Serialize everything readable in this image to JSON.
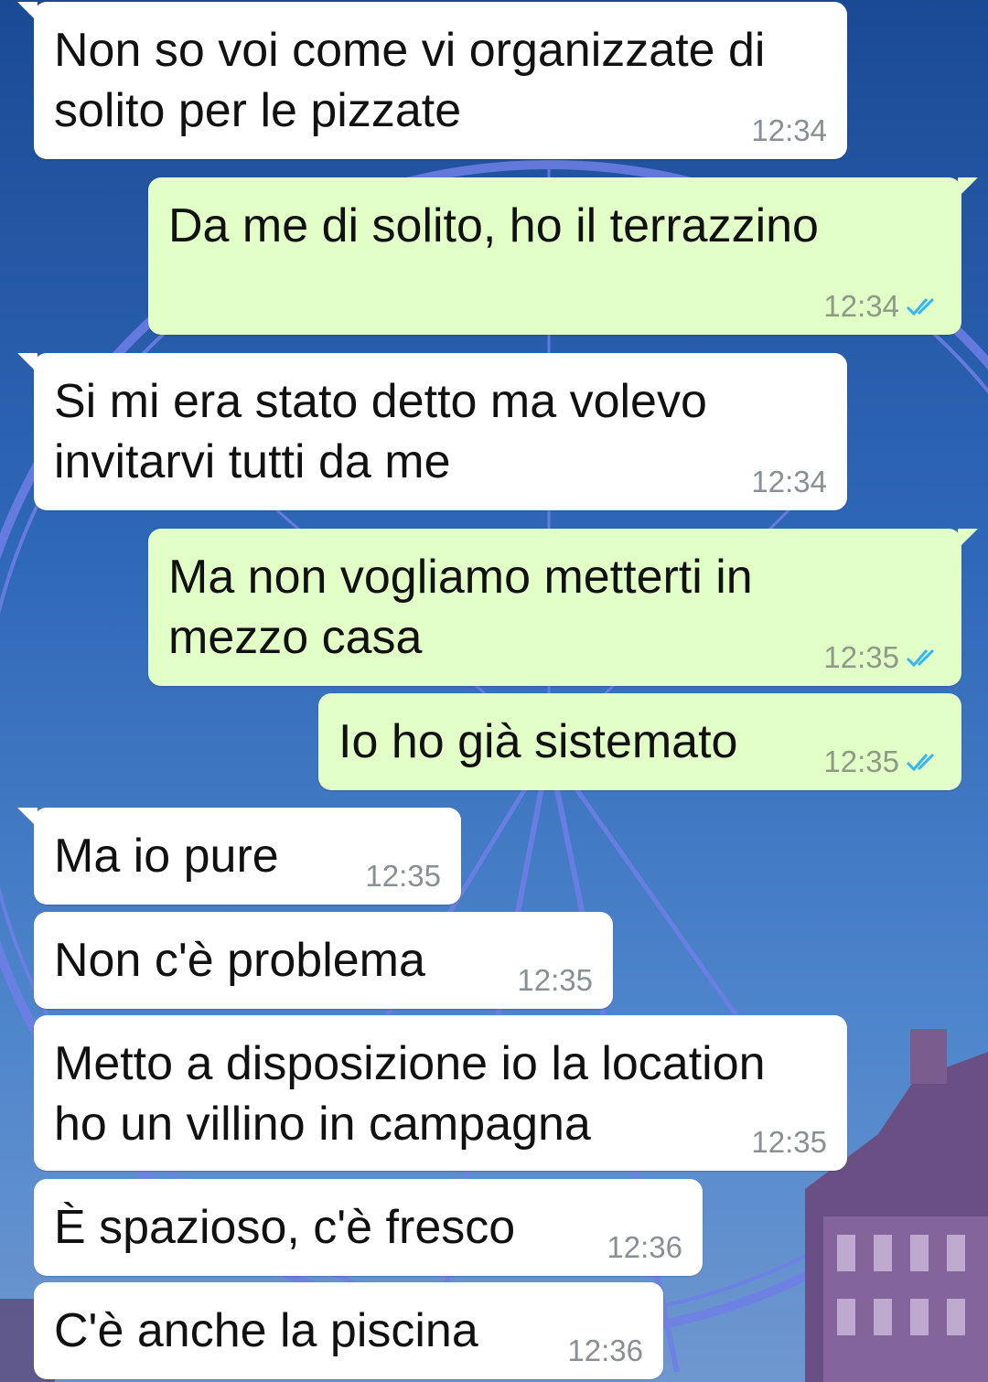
{
  "colors": {
    "incoming_bubble": "#ffffff",
    "outgoing_bubble": "#e1ffc7",
    "read_ticks": "#34b7f1",
    "text": "#111111",
    "time": "#8a8f93"
  },
  "wallpaper": {
    "subject": "ferris wheel at dusk",
    "icon": "wallpaper-image"
  },
  "messages": [
    {
      "direction": "in",
      "text": "Non so voi come vi organizzate di\nsolito per le pizzate",
      "time": "12:34"
    },
    {
      "direction": "out",
      "text": "Da me di solito, ho il terrazzino",
      "time": "12:34",
      "status": "read"
    },
    {
      "direction": "in",
      "text": "Si mi era stato detto ma volevo\ninvitarvi tutti da me",
      "time": "12:34"
    },
    {
      "direction": "out",
      "text": "Ma non vogliamo metterti in\nmezzo casa",
      "time": "12:35",
      "status": "read"
    },
    {
      "direction": "out",
      "text": "Io ho già sistemato",
      "time": "12:35",
      "status": "read"
    },
    {
      "direction": "in",
      "text": "Ma io pure",
      "time": "12:35"
    },
    {
      "direction": "in",
      "text": "Non c'è problema",
      "time": "12:35"
    },
    {
      "direction": "in",
      "text": "Metto a disposizione io la location\nho un villino in campagna",
      "time": "12:35"
    },
    {
      "direction": "in",
      "text": "È spazioso, c'è fresco",
      "time": "12:36"
    },
    {
      "direction": "in",
      "text": "C'è anche la piscina",
      "time": "12:36"
    }
  ]
}
